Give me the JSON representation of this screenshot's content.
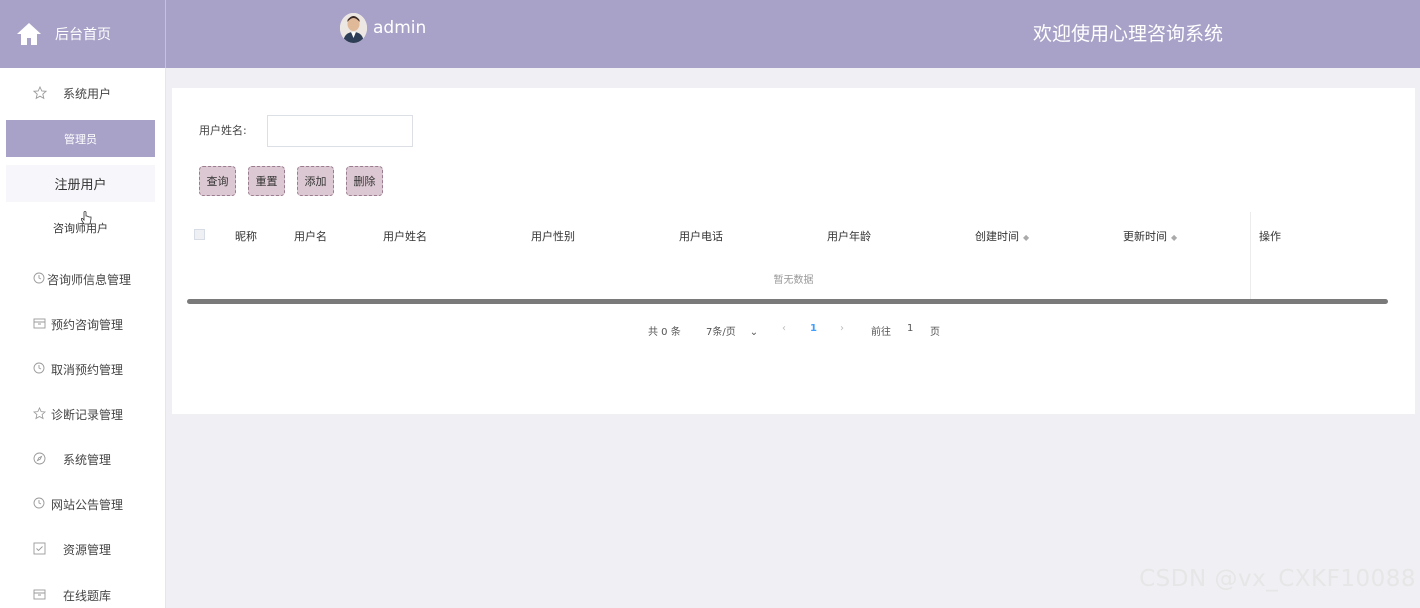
{
  "header": {
    "home_label": "后台首页",
    "user_name": "admin",
    "welcome": "欢迎使用心理咨询系统"
  },
  "sidebar": {
    "items": [
      {
        "label": "系统用户",
        "icon": "star-icon"
      },
      {
        "label": "咨询师信息管理",
        "icon": "clock-icon"
      },
      {
        "label": "预约咨询管理",
        "icon": "box-icon"
      },
      {
        "label": "取消预约管理",
        "icon": "clock-icon"
      },
      {
        "label": "诊断记录管理",
        "icon": "star-icon"
      },
      {
        "label": "系统管理",
        "icon": "compass-icon"
      },
      {
        "label": "网站公告管理",
        "icon": "clock-icon"
      },
      {
        "label": "资源管理",
        "icon": "checkbox-icon"
      },
      {
        "label": "在线题库",
        "icon": "box-icon"
      }
    ],
    "sub_items": [
      {
        "label": "管理员"
      },
      {
        "label": "注册用户"
      },
      {
        "label": "咨询师用户"
      }
    ]
  },
  "search": {
    "label": "用户姓名:",
    "value": "",
    "placeholder": ""
  },
  "buttons": {
    "query": "查询",
    "reset": "重置",
    "add": "添加",
    "delete": "删除"
  },
  "table": {
    "columns": [
      "昵称",
      "用户名",
      "用户姓名",
      "用户性别",
      "用户电话",
      "用户年龄",
      "创建时间",
      "更新时间",
      "操作"
    ],
    "empty_text": "暂无数据"
  },
  "pagination": {
    "total": "共 0 条",
    "page_size": "7条/页",
    "current_page": "1",
    "goto_label": "前往",
    "goto_value": "1",
    "page_unit": "页"
  },
  "watermark": "CSDN @vx_CXKF10088",
  "colors": {
    "header_bg": "#a8a2c8",
    "active_item": "#a8a2c8",
    "button_bg": "#dcc8d2",
    "page_active": "#409eff"
  }
}
